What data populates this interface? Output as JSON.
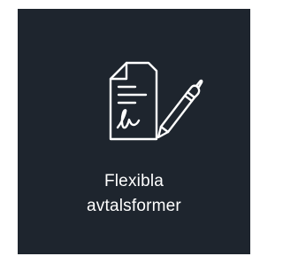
{
  "tile": {
    "label_line1": "Flexibla",
    "label_line2": "avtalsformer",
    "icon": "signed-contract-pen-icon",
    "colors": {
      "background": "#1e252e",
      "foreground": "#ffffff",
      "page": "#ffffff"
    }
  }
}
